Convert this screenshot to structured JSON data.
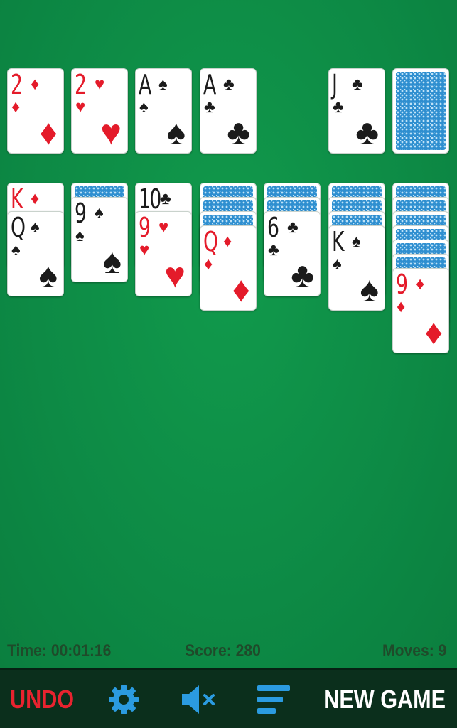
{
  "foundations": [
    {
      "rank": "2",
      "suit": "♦",
      "color": "red"
    },
    {
      "rank": "2",
      "suit": "♥",
      "color": "red"
    },
    {
      "rank": "A",
      "suit": "♠",
      "color": "black"
    },
    {
      "rank": "A",
      "suit": "♣",
      "color": "black"
    }
  ],
  "waste": {
    "rank": "J",
    "suit": "♣",
    "color": "black"
  },
  "stock": {
    "face_down": true
  },
  "tableau": [
    {
      "face_down": 0,
      "face_up": [
        {
          "rank": "K",
          "suit": "♦",
          "color": "red"
        },
        {
          "rank": "Q",
          "suit": "♠",
          "color": "black"
        }
      ]
    },
    {
      "face_down": 1,
      "face_up": [
        {
          "rank": "9",
          "suit": "♠",
          "color": "black"
        }
      ]
    },
    {
      "face_down": 0,
      "face_up": [
        {
          "rank": "10",
          "suit": "♣",
          "color": "black"
        },
        {
          "rank": "9",
          "suit": "♥",
          "color": "red"
        }
      ]
    },
    {
      "face_down": 3,
      "face_up": [
        {
          "rank": "Q",
          "suit": "♦",
          "color": "red"
        }
      ]
    },
    {
      "face_down": 2,
      "face_up": [
        {
          "rank": "6",
          "suit": "♣",
          "color": "black"
        }
      ]
    },
    {
      "face_down": 3,
      "face_up": [
        {
          "rank": "K",
          "suit": "♠",
          "color": "black"
        }
      ]
    },
    {
      "face_down": 6,
      "face_up": [
        {
          "rank": "9",
          "suit": "♦",
          "color": "red"
        }
      ]
    }
  ],
  "status": {
    "time": "Time: 00:01:16",
    "score": "Score: 280",
    "moves": "Moves: 9"
  },
  "toolbar": {
    "undo_label": "UNDO",
    "new_game_label": "NEW GAME",
    "settings_icon": "gear-icon",
    "sound_icon": "speaker-muted-icon",
    "menu_icon": "menu-icon"
  },
  "colors": {
    "table_green": "#0e8a45",
    "toolbar_bg": "#0b2f1c",
    "undo_red": "#e8232f",
    "icon_blue": "#2b9be0",
    "card_back_blue": "#2f8fd0",
    "status_text": "#1f4a2a"
  }
}
